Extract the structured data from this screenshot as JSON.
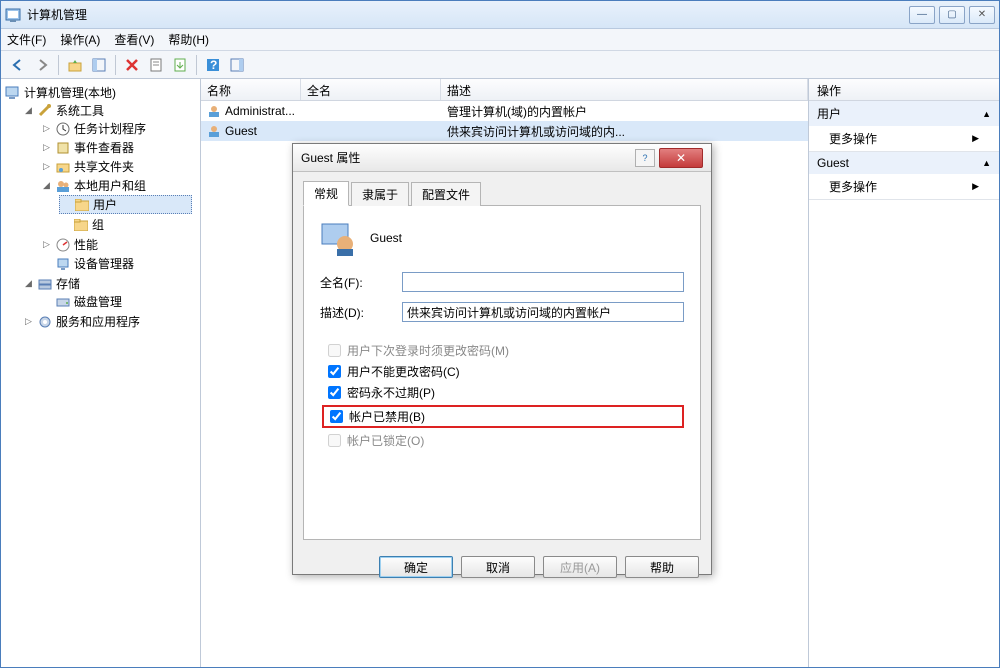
{
  "window": {
    "title": "计算机管理"
  },
  "menu": {
    "file": "文件(F)",
    "action": "操作(A)",
    "view": "查看(V)",
    "help": "帮助(H)"
  },
  "tree": {
    "root": "计算机管理(本地)",
    "system_tools": "系统工具",
    "task_scheduler": "任务计划程序",
    "event_viewer": "事件查看器",
    "shared_folders": "共享文件夹",
    "local_users": "本地用户和组",
    "users": "用户",
    "groups": "组",
    "performance": "性能",
    "device_manager": "设备管理器",
    "storage": "存储",
    "disk_mgmt": "磁盘管理",
    "services_apps": "服务和应用程序"
  },
  "list": {
    "headers": {
      "name": "名称",
      "fullname": "全名",
      "desc": "描述"
    },
    "rows": [
      {
        "name": "Administrat...",
        "fullname": "",
        "desc": "管理计算机(域)的内置帐户"
      },
      {
        "name": "Guest",
        "fullname": "",
        "desc": "供来宾访问计算机或访问域的内..."
      }
    ]
  },
  "actions": {
    "title": "操作",
    "group1": "用户",
    "more1": "更多操作",
    "group2": "Guest",
    "more2": "更多操作"
  },
  "dialog": {
    "title": "Guest 属性",
    "tabs": {
      "general": "常规",
      "memberof": "隶属于",
      "profile": "配置文件"
    },
    "username": "Guest",
    "fullname_label": "全名(F):",
    "fullname_value": "",
    "desc_label": "描述(D):",
    "desc_value": "供来宾访问计算机或访问域的内置帐户",
    "chk_must_change": "用户下次登录时须更改密码(M)",
    "chk_cannot_change": "用户不能更改密码(C)",
    "chk_never_expire": "密码永不过期(P)",
    "chk_disabled": "帐户已禁用(B)",
    "chk_locked": "帐户已锁定(O)",
    "btn_ok": "确定",
    "btn_cancel": "取消",
    "btn_apply": "应用(A)",
    "btn_help": "帮助"
  }
}
